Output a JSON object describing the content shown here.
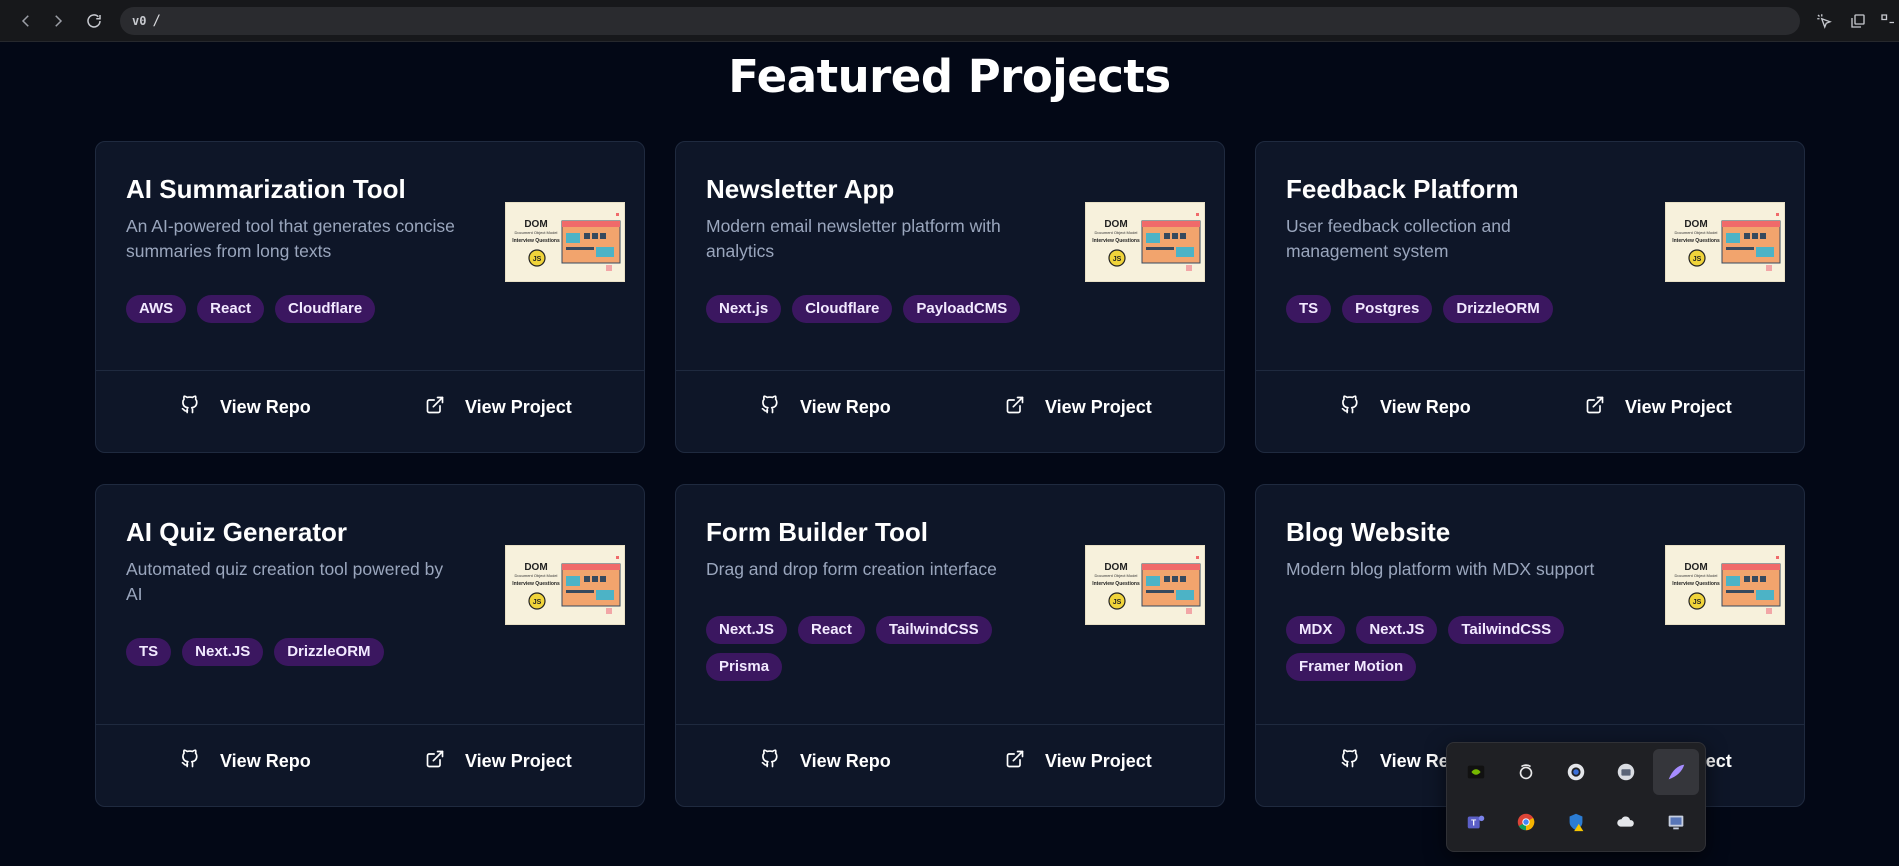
{
  "browser": {
    "url": "/",
    "url_prefix_icon": "v0-logo-icon"
  },
  "section": {
    "title": "Featured Projects"
  },
  "projects": [
    {
      "title": "AI Summarization Tool",
      "description": "An AI-powered tool that generates concise summaries from long texts",
      "tags": [
        "AWS",
        "React",
        "Cloudflare"
      ],
      "repo_label": "View Repo",
      "project_label": "View Project"
    },
    {
      "title": "Newsletter App",
      "description": "Modern email newsletter platform with analytics",
      "tags": [
        "Next.js",
        "Cloudflare",
        "PayloadCMS"
      ],
      "repo_label": "View Repo",
      "project_label": "View Project"
    },
    {
      "title": "Feedback Platform",
      "description": "User feedback collection and management system",
      "tags": [
        "TS",
        "Postgres",
        "DrizzleORM"
      ],
      "repo_label": "View Repo",
      "project_label": "View Project"
    },
    {
      "title": "AI Quiz Generator",
      "description": "Automated quiz creation tool powered by AI",
      "tags": [
        "TS",
        "Next.JS",
        "DrizzleORM"
      ],
      "repo_label": "View Repo",
      "project_label": "View Project"
    },
    {
      "title": "Form Builder Tool",
      "description": "Drag and drop form creation interface",
      "tags": [
        "Next.JS",
        "React",
        "TailwindCSS",
        "Prisma"
      ],
      "repo_label": "View Repo",
      "project_label": "View Project"
    },
    {
      "title": "Blog Website",
      "description": "Modern blog platform with MDX support",
      "tags": [
        "MDX",
        "Next.JS",
        "TailwindCSS",
        "Framer Motion"
      ],
      "repo_label": "View Repo",
      "project_label": "View Project"
    }
  ],
  "thumbnail": {
    "line1": "DOM",
    "line2": "Document Object Model",
    "line3": "Interview Questions",
    "badge": "JS"
  },
  "tray": {
    "icons": [
      "nvidia-icon",
      "copilot-icon",
      "steam-icon",
      "vpn-icon",
      "feather-icon",
      "teams-icon",
      "chrome-icon",
      "defender-warning-icon",
      "onedrive-icon",
      "display-icon"
    ]
  },
  "colors": {
    "background": "#030816",
    "card": "#0e1628",
    "tag_bg": "#3b1760",
    "muted_text": "#9aa6bd"
  }
}
